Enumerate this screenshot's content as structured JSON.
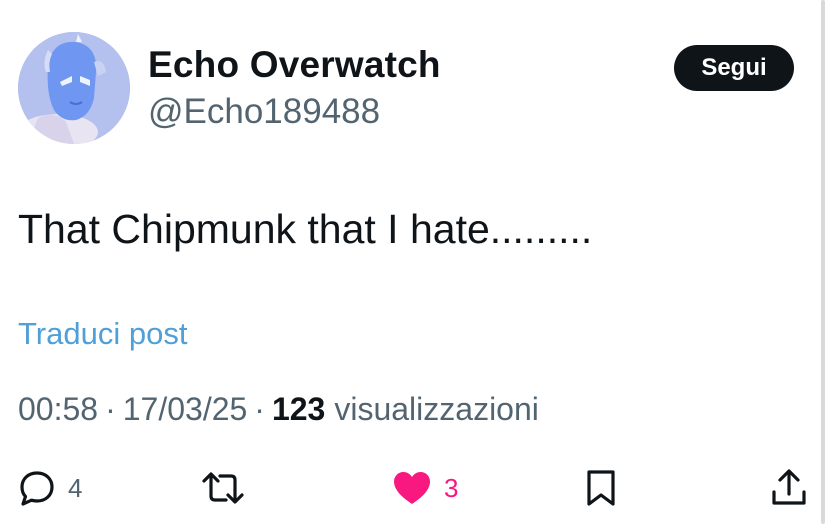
{
  "author": {
    "display_name": "Echo Overwatch",
    "handle": "@Echo189488",
    "avatar_icon": "avatar-image"
  },
  "follow_button": {
    "label": "Segui"
  },
  "post": {
    "text": "That Chipmunk that I hate.........",
    "translate_label": "Traduci post"
  },
  "meta": {
    "time": "00:58",
    "separator": "·",
    "date": "17/03/25",
    "views_count": "123",
    "views_label": "visualizzazioni"
  },
  "actions": {
    "reply": {
      "icon": "reply-icon",
      "count": "4"
    },
    "repost": {
      "icon": "repost-icon"
    },
    "like": {
      "icon": "heart-icon",
      "count": "3",
      "color": "#f91880"
    },
    "bookmark": {
      "icon": "bookmark-icon"
    },
    "share": {
      "icon": "share-icon"
    }
  },
  "colors": {
    "text_primary": "#0f1419",
    "text_secondary": "#536471",
    "link": "#4f9fd8",
    "button_bg": "#0f1419",
    "like": "#f91880"
  }
}
